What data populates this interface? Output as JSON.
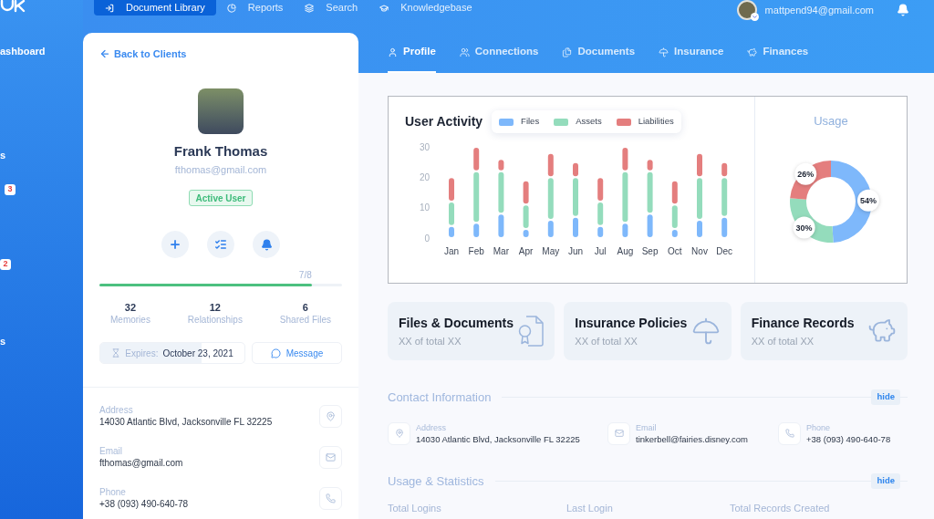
{
  "top_nav": {
    "items": [
      {
        "label": "Document Library",
        "selected": true
      },
      {
        "label": "Reports",
        "selected": false
      },
      {
        "label": "Search",
        "selected": false
      },
      {
        "label": "Knowledgebase",
        "selected": false
      }
    ],
    "user_email": "mattpend94@gmail.com"
  },
  "sidebar": {
    "items": [
      {
        "kind": "label",
        "text": "ashboard"
      },
      {
        "kind": "label",
        "text": "s"
      },
      {
        "kind": "badge",
        "text": "3"
      },
      {
        "kind": "badge",
        "text": "2"
      },
      {
        "kind": "label",
        "text": "s"
      }
    ]
  },
  "profile": {
    "back_link": "Back to Clients",
    "name": "Frank Thomas",
    "email": "fthomas@gmail.com",
    "status": "Active User",
    "progress": {
      "reading": "7/8",
      "level": 0.875
    },
    "stats": [
      {
        "value": "32",
        "label": "Memories"
      },
      {
        "value": "12",
        "label": "Relationships"
      },
      {
        "value": "6",
        "label": "Shared Files"
      }
    ],
    "expires": {
      "label": "Expires:",
      "date": "October 23, 2021",
      "level": 0.7
    },
    "message_button": "Message",
    "contacts": [
      {
        "label": "Address",
        "value": "14030 Atlantic Blvd, Jacksonville FL 32225"
      },
      {
        "label": "Email",
        "value": "fthomas@gmail.com"
      },
      {
        "label": "Phone",
        "value": "+38 (093) 490-640-78"
      }
    ]
  },
  "tabs": [
    {
      "label": "Profile",
      "selected": true
    },
    {
      "label": "Connections",
      "selected": false
    },
    {
      "label": "Documents",
      "selected": false
    },
    {
      "label": "Insurance",
      "selected": false
    },
    {
      "label": "Finances",
      "selected": false
    }
  ],
  "activity_chart": {
    "chart_data": {
      "type": "bar",
      "title": "User Activity",
      "legend": "top",
      "categories": [
        "Jan",
        "Feb",
        "Mar",
        "Apr",
        "May",
        "Jun",
        "Jul",
        "Aug",
        "Sep",
        "Oct",
        "Nov",
        "Dec"
      ],
      "series": [
        {
          "name": "Files",
          "color": "#7eb8fb",
          "values": [
            4,
            5,
            8,
            3,
            6,
            7,
            4,
            5,
            8,
            3,
            6,
            7
          ]
        },
        {
          "name": "Assets",
          "color": "#94dcbc",
          "values": [
            8,
            17,
            14,
            8,
            14,
            13,
            8,
            17,
            14,
            8,
            14,
            13
          ]
        },
        {
          "name": "Liabilities",
          "color": "#e47e7e",
          "values": [
            8,
            8,
            4,
            8,
            8,
            5,
            8,
            8,
            4,
            8,
            8,
            5
          ]
        }
      ],
      "ylim": [
        0,
        30
      ],
      "yticks": [
        0,
        10,
        20,
        30
      ],
      "stacked": true
    }
  },
  "usage_chart": {
    "chart_data": {
      "type": "donut",
      "title": "Usage",
      "values": [
        54,
        30,
        26
      ],
      "colors": [
        "#7eb8fb",
        "#94dcbc",
        "#e47e7e"
      ],
      "value_labels": [
        "54%",
        "30%",
        "26%"
      ]
    }
  },
  "summary_cards": [
    {
      "title": "Files & Documents",
      "subtitle": "XX of total XX"
    },
    {
      "title": "Insurance Policies",
      "subtitle": "XX of total XX"
    },
    {
      "title": "Finance Records",
      "subtitle": "XX of total XX"
    }
  ],
  "contact_information": {
    "title": "Contact Information",
    "hide_label": "hide",
    "items": [
      {
        "label": "Address",
        "value": "14030 Atlantic Blvd, Jacksonville FL 32225"
      },
      {
        "label": "Email",
        "value": "tinkerbell@fairies.disney.com"
      },
      {
        "label": "Phone",
        "value": "+38 (093) 490-640-78"
      }
    ]
  },
  "usage_statistics": {
    "title": "Usage & Statistics",
    "hide_label": "hide",
    "columns": [
      "Total Logins",
      "Last Login",
      "Total Records Created"
    ]
  }
}
